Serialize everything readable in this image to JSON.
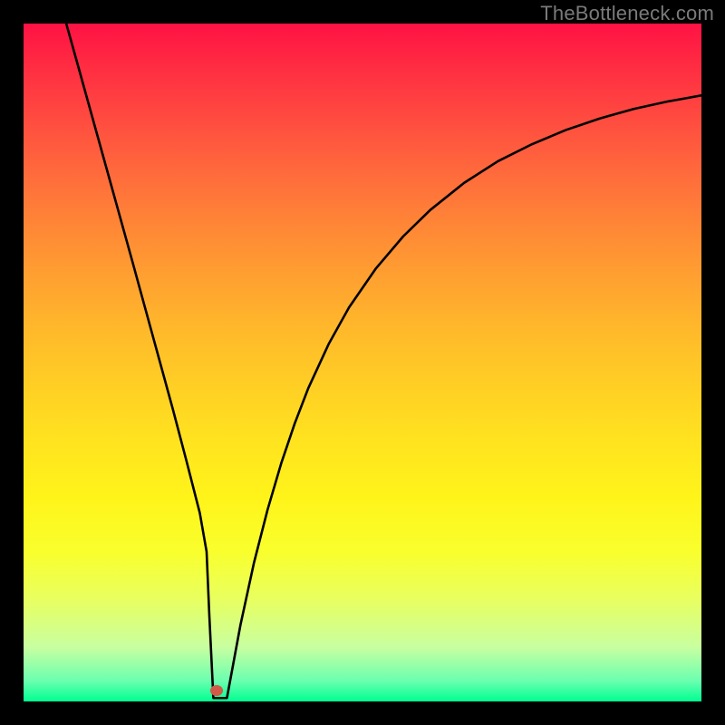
{
  "watermark": "TheBottleneck.com",
  "chart_data": {
    "type": "line",
    "title": "",
    "xlabel": "",
    "ylabel": "",
    "xlim": [
      0,
      100
    ],
    "ylim": [
      0,
      100
    ],
    "series": [
      {
        "name": "bottleneck-curve",
        "x": [
          6.3,
          8,
          10,
          12,
          14,
          16,
          18,
          20,
          22,
          24,
          25,
          26,
          27,
          27.4,
          28,
          29,
          30,
          31,
          32,
          34,
          36,
          38,
          40,
          42,
          45,
          48,
          52,
          56,
          60,
          65,
          70,
          75,
          80,
          85,
          90,
          95,
          100
        ],
        "y": [
          100,
          93.9,
          86.7,
          79.5,
          72.3,
          65.1,
          57.8,
          50.5,
          43.2,
          35.6,
          31.7,
          27.8,
          22.1,
          12.8,
          0.5,
          0.5,
          0.5,
          5.9,
          11.3,
          20.5,
          28.3,
          35.1,
          41.0,
          46.2,
          52.7,
          58.1,
          63.9,
          68.6,
          72.5,
          76.5,
          79.7,
          82.2,
          84.3,
          86.0,
          87.4,
          88.5,
          89.4
        ]
      }
    ],
    "marker": {
      "x": 28.5,
      "y": 1.6,
      "color": "#d15a48"
    },
    "gradient_colors": {
      "top": "#ff1244",
      "mid": "#ffd024",
      "bottom": "#00ff91"
    }
  }
}
